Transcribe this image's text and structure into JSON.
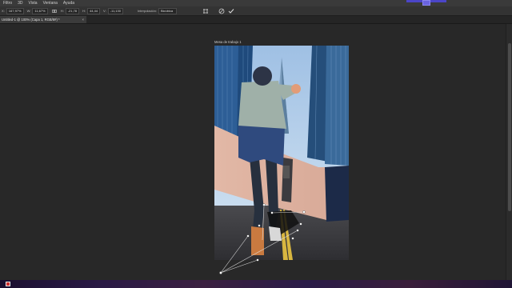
{
  "menu": {
    "items": [
      "Filtro",
      "3D",
      "Vista",
      "Ventana",
      "Ayuda"
    ]
  },
  "options": {
    "x_label": "X:",
    "x_value": "167,97%",
    "w_label": "W:",
    "w_value": "11,67%",
    "h_label": "H:",
    "h_value": "-21,78",
    "angle_label": "H:",
    "angle_value": "44,44",
    "v_label": "V:",
    "v_value": "-11,130",
    "interp_label": "Interpolación:",
    "interp_value": "Bicúbica"
  },
  "document": {
    "tab_label": "Untitled-1 @ 100% (Capa 1, RGB/8#) *",
    "artboard_label": "Mesa de trabajo 1"
  },
  "colors": {
    "accent": "#4b45c8",
    "workspace": "#282828",
    "handle": "#ffffff"
  }
}
